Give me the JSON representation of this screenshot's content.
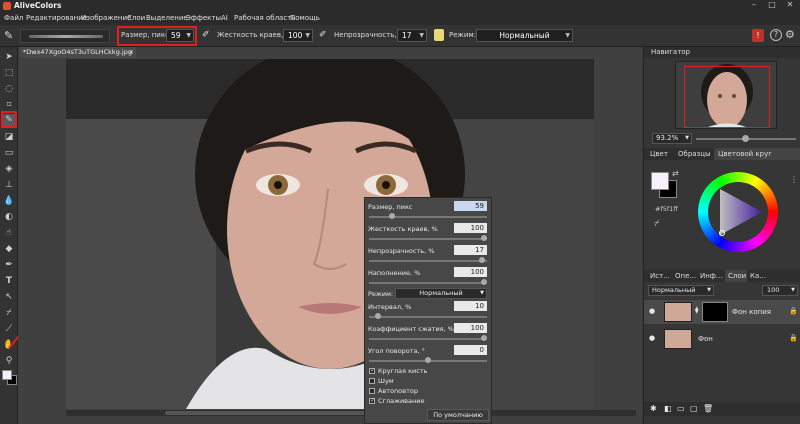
{
  "app": {
    "title": "AliveColors"
  },
  "menu": [
    "Файл",
    "Редактирование",
    "Изображение",
    "Слои",
    "Выделение",
    "Эффекты",
    "AI",
    "Рабочая область",
    "Помощь"
  ],
  "options": {
    "size_label": "Размер, пикс",
    "size_value": "59",
    "hardness_label": "Жесткость краев, %",
    "hardness_value": "100",
    "opacity_label": "Непрозрачность, %",
    "opacity_value": "17",
    "mode_label": "Режим:",
    "mode_value": "Нормальный"
  },
  "document": {
    "tab_name": "*Dwx47XgoO4sT3uTGLHCkkg.jpg"
  },
  "popup": {
    "size_label": "Размер, пикс",
    "size_value": "59",
    "size_frac": 0.18,
    "hardness_label": "Жесткость краев, %",
    "hardness_value": "100",
    "hardness_frac": 1.0,
    "opacity_label": "Непрозрачность, %",
    "opacity_value": "17",
    "opacity_frac": 0.98,
    "fill_label": "Наполнение, %",
    "fill_value": "100",
    "fill_frac": 1.0,
    "mode_label": "Режим:",
    "mode_value": "Нормальный",
    "interval_label": "Интервал, %",
    "interval_value": "10",
    "interval_frac": 0.05,
    "compress_label": "Коэффициент сжатия, %",
    "compress_value": "100",
    "compress_frac": 1.0,
    "angle_label": "Угол поворота, °",
    "angle_value": "0",
    "angle_frac": 0.5,
    "checks": [
      {
        "label": "Круглая кисть",
        "checked": true
      },
      {
        "label": "Шум",
        "checked": false
      },
      {
        "label": "Автоповтор",
        "checked": false
      },
      {
        "label": "Сглаживание",
        "checked": true
      }
    ],
    "default_button": "По умолчанию"
  },
  "navigator": {
    "title": "Навигатор",
    "zoom": "93.2%"
  },
  "color_panel": {
    "tabs": [
      "Цвет",
      "Образцы",
      "Цветовой круг"
    ],
    "active_tab": "Цветовой круг",
    "hex": "#f5f1ff",
    "fg_color": "#f5f1ff",
    "bg_color": "#000000"
  },
  "layers_panel": {
    "tabs": [
      "Ист...",
      "Опе...",
      "Инф...",
      "Слои",
      "Ка..."
    ],
    "active_tab": "Слои",
    "blend_mode": "Нормальный",
    "opacity": "100",
    "layers": [
      {
        "name": "Фон копия"
      },
      {
        "name": "Фон"
      }
    ]
  },
  "colors": {
    "accent_red": "#e02020",
    "panel": "#363636"
  }
}
